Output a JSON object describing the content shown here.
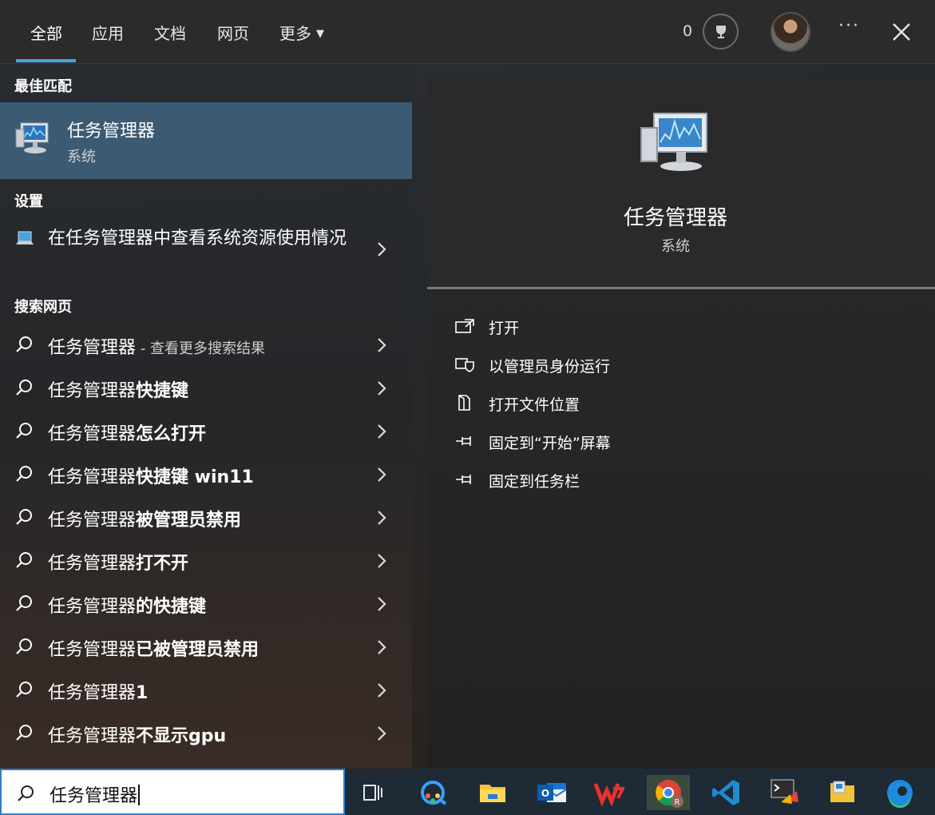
{
  "tabs": [
    {
      "label": "全部",
      "active": true
    },
    {
      "label": "应用"
    },
    {
      "label": "文档"
    },
    {
      "label": "网页"
    },
    {
      "label": "更多"
    }
  ],
  "header": {
    "points": "0",
    "more_icon": "ellipsis-icon",
    "close_icon": "close-icon"
  },
  "best_match": {
    "section_title": "最佳匹配",
    "title": "任务管理器",
    "subtitle": "系统"
  },
  "settings": {
    "section_title": "设置",
    "item": "在任务管理器中查看系统资源使用情况"
  },
  "web": {
    "section_title": "搜索网页",
    "first": {
      "query": "任务管理器",
      "suffix": " - 查看更多搜索结果"
    },
    "items": [
      {
        "base": "任务管理器",
        "extra": "快捷键"
      },
      {
        "base": "任务管理器",
        "extra": "怎么打开"
      },
      {
        "base": "任务管理器",
        "extra": "快捷键 win11"
      },
      {
        "base": "任务管理器",
        "extra": "被管理员禁用"
      },
      {
        "base": "任务管理器",
        "extra": "打不开"
      },
      {
        "base": "任务管理器",
        "extra": "的快捷键"
      },
      {
        "base": "任务管理器",
        "extra": "已被管理员禁用"
      },
      {
        "base": "任务管理器",
        "extra": "1"
      },
      {
        "base": "任务管理器",
        "extra": "不显示gpu"
      }
    ]
  },
  "preview": {
    "title": "任务管理器",
    "subtitle": "系统",
    "actions": [
      {
        "label": "打开",
        "icon": "open-icon"
      },
      {
        "label": "以管理员身份运行",
        "icon": "shield-icon"
      },
      {
        "label": "打开文件位置",
        "icon": "file-location-icon"
      },
      {
        "label": "固定到“开始”屏幕",
        "icon": "pin-icon"
      },
      {
        "label": "固定到任务栏",
        "icon": "pin-icon"
      }
    ]
  },
  "search": {
    "value": "任务管理器"
  },
  "colors": {
    "accent": "#4aa3df",
    "highlight": "#3c5a72"
  }
}
